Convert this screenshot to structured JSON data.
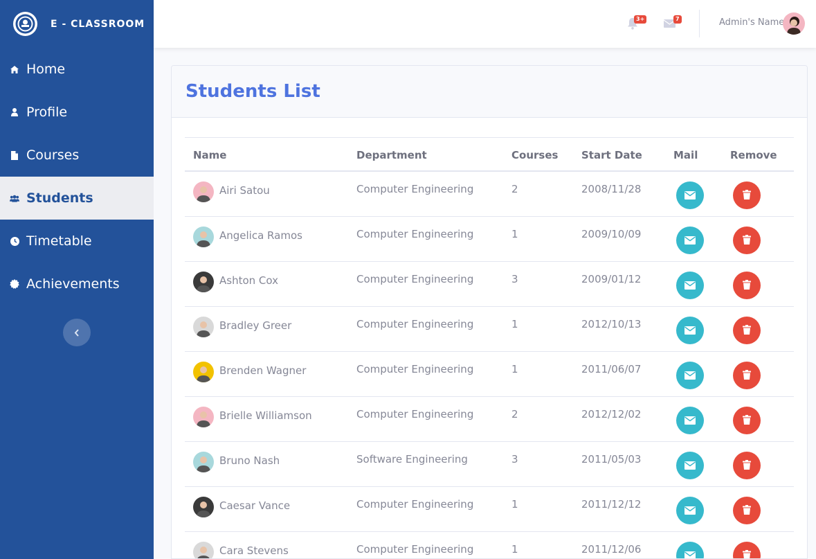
{
  "brand": {
    "title": "E - CLASSROOM"
  },
  "sidebar": {
    "items": [
      {
        "label": "Home",
        "icon": "home-icon"
      },
      {
        "label": "Profile",
        "icon": "user-icon"
      },
      {
        "label": "Courses",
        "icon": "file-icon"
      },
      {
        "label": "Students",
        "icon": "users-icon",
        "active": true
      },
      {
        "label": "Timetable",
        "icon": "clock-icon"
      },
      {
        "label": "Achievements",
        "icon": "badge-icon"
      }
    ]
  },
  "topbar": {
    "alerts_badge": "3+",
    "messages_badge": "7",
    "user_name": "Admin's Name"
  },
  "page": {
    "title": "Students List"
  },
  "table": {
    "headers": {
      "name": "Name",
      "department": "Department",
      "courses": "Courses",
      "start_date": "Start Date",
      "mail": "Mail",
      "remove": "Remove"
    },
    "rows": [
      {
        "name": "Airi Satou",
        "department": "Computer Engineering",
        "courses": "2",
        "start_date": "2008/11/28",
        "avatar_color": "#f4b6c2"
      },
      {
        "name": "Angelica Ramos",
        "department": "Computer Engineering",
        "courses": "1",
        "start_date": "2009/10/09",
        "avatar_color": "#a8d8dc"
      },
      {
        "name": "Ashton Cox",
        "department": "Computer Engineering",
        "courses": "3",
        "start_date": "2009/01/12",
        "avatar_color": "#3a3a3a"
      },
      {
        "name": "Bradley Greer",
        "department": "Computer Engineering",
        "courses": "1",
        "start_date": "2012/10/13",
        "avatar_color": "#d9d9d9"
      },
      {
        "name": "Brenden Wagner",
        "department": "Computer Engineering",
        "courses": "1",
        "start_date": "2011/06/07",
        "avatar_color": "#f2c200"
      },
      {
        "name": "Brielle Williamson",
        "department": "Computer Engineering",
        "courses": "2",
        "start_date": "2012/12/02",
        "avatar_color": "#f4b6c2"
      },
      {
        "name": "Bruno Nash",
        "department": "Software Engineering",
        "courses": "3",
        "start_date": "2011/05/03",
        "avatar_color": "#a8d8dc"
      },
      {
        "name": "Caesar Vance",
        "department": "Computer Engineering",
        "courses": "1",
        "start_date": "2011/12/12",
        "avatar_color": "#3a3a3a"
      },
      {
        "name": "Cara Stevens",
        "department": "Computer Engineering",
        "courses": "1",
        "start_date": "2011/12/06",
        "avatar_color": "#d9d9d9"
      }
    ]
  },
  "colors": {
    "sidebar": "#23529a",
    "accent": "#4e73df",
    "mail": "#36b9cc",
    "remove": "#e74a3b"
  }
}
